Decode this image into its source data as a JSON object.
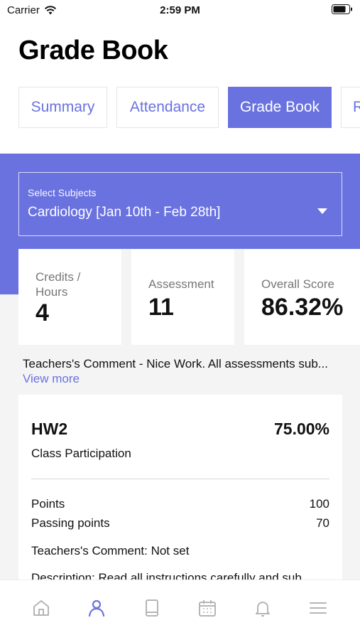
{
  "status": {
    "carrier": "Carrier",
    "time": "2:59 PM"
  },
  "page": {
    "title": "Grade Book"
  },
  "tabs": [
    {
      "label": "Summary",
      "active": false
    },
    {
      "label": "Attendance",
      "active": false
    },
    {
      "label": "Grade Book",
      "active": true
    },
    {
      "label": "R",
      "active": false
    }
  ],
  "subject_select": {
    "label": "Select Subjects",
    "value": "Cardiology [Jan 10th - Feb 28th]"
  },
  "stats": {
    "credits": {
      "label": "Credits / Hours",
      "value": "4"
    },
    "assessment": {
      "label": "Assessment",
      "value": "11"
    },
    "overall": {
      "label": "Overall Score",
      "value": "86.32%"
    }
  },
  "comment": {
    "text": "Teachers's Comment - Nice Work. All assessments sub...",
    "view_more": "View more"
  },
  "grade": {
    "name": "HW2",
    "score": "75.00%",
    "category": "Class Participation",
    "points_label": "Points",
    "points_value": "100",
    "passing_label": "Passing points",
    "passing_value": "70",
    "teacher_comment": "Teachers's Comment: Not set",
    "description": "Description: Read all instructions carefully and sub..."
  },
  "bottom_nav": [
    "home-icon",
    "profile-icon",
    "book-icon",
    "calendar-icon",
    "bell-icon",
    "menu-icon"
  ],
  "colors": {
    "accent": "#6a72e0",
    "background": "#f4f4f4",
    "inactive_icon": "#b5b5b5"
  }
}
